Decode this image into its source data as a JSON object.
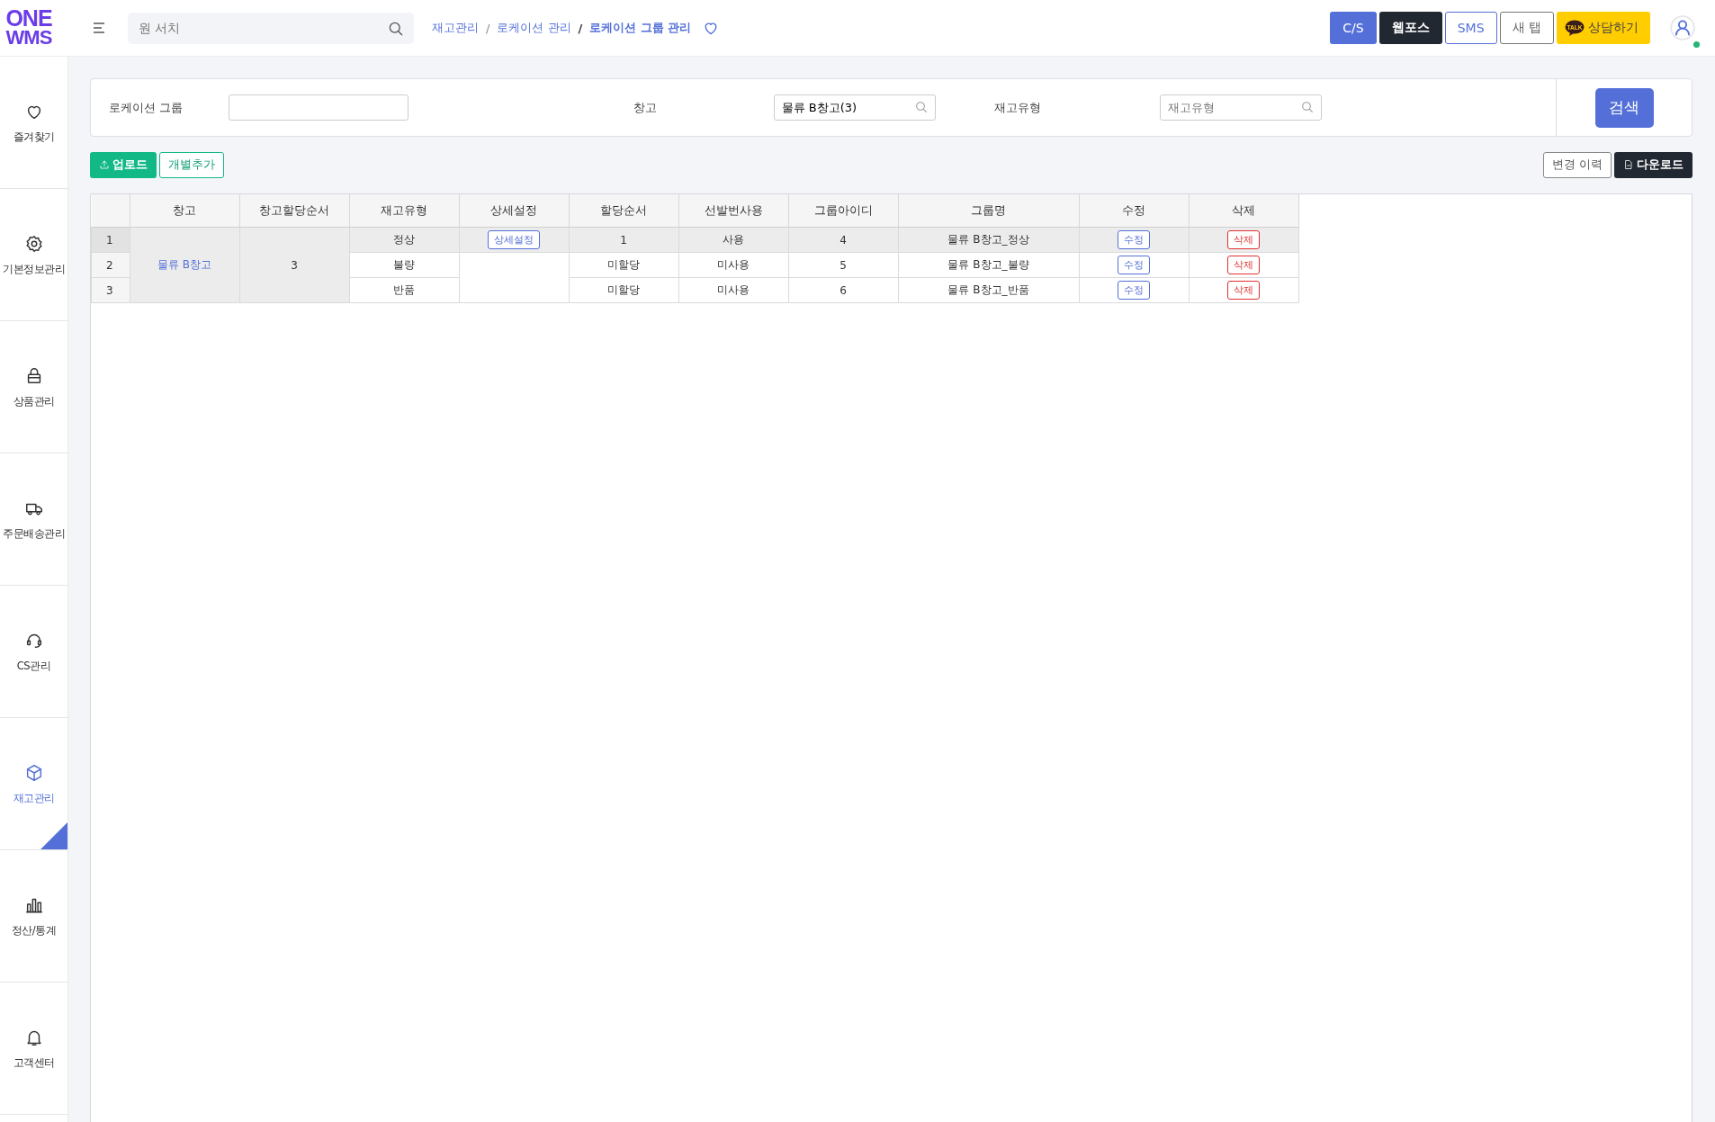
{
  "header": {
    "logo": [
      "ONE",
      "WMS"
    ],
    "search": {
      "placeholder": "원 서치"
    },
    "breadcrumb": [
      {
        "label": "재고관리",
        "current": false
      },
      {
        "separator": "/",
        "label": "로케이션 관리",
        "current": false
      },
      {
        "separator": "/",
        "label": "로케이션 그룹 관리",
        "current": true
      }
    ],
    "favorite": {
      "on": false
    },
    "buttons": [
      {
        "label": "C/S",
        "kind": "primary"
      },
      {
        "label": "웹포스",
        "kind": "dark"
      },
      {
        "label": "SMS",
        "kind": "outline-blue"
      },
      {
        "label": "새 탭",
        "kind": "outline-grey"
      },
      {
        "label": "상담하기",
        "kind": "talk",
        "icon_text": "TALK"
      }
    ],
    "user": {
      "online": true
    }
  },
  "sidebar": {
    "items": [
      {
        "label": "즐겨찾기",
        "selected": false
      },
      {
        "label": "기본정보관리",
        "selected": false
      },
      {
        "label": "상품관리",
        "selected": false
      },
      {
        "label": "주문배송관리",
        "selected": false
      },
      {
        "label": "CS관리",
        "selected": false
      },
      {
        "label": "재고관리",
        "selected": true
      },
      {
        "label": "정산/통계",
        "selected": false
      },
      {
        "label": "고객센터",
        "selected": false
      }
    ]
  },
  "filters": [
    {
      "label": "로케이션 그룹",
      "kind": "text"
    },
    {
      "label": "창고",
      "kind": "select",
      "value": "물류 B창고(3)"
    },
    {
      "label": "재고유형",
      "kind": "select",
      "placeholder": "재고유형"
    }
  ],
  "search_button": "검색",
  "toolbar": {
    "left": [
      {
        "label": "업로드",
        "kind": "upload"
      },
      {
        "label": "개별추가",
        "kind": "outline"
      }
    ],
    "right": [
      {
        "label": "변경 이력",
        "kind": "outline"
      },
      {
        "label": "다운로드",
        "kind": "download"
      }
    ]
  },
  "table": {
    "columns": [
      "창고",
      "창고할당순서",
      "재고유형",
      "상세설정",
      "할당순서",
      "선발번사용",
      "그룹아이디",
      "그룹명",
      "수정",
      "삭제"
    ],
    "warehouse": "물류 B창고",
    "warehouse_order": "3",
    "rows": [
      {
        "number": "1",
        "selected": true,
        "stock_type": "정상",
        "detail_button": "상세설정",
        "alloc_order": "1",
        "first_use": "사용",
        "group_id": "4",
        "group_name": "물류 B창고_정상",
        "edit": "수정",
        "delete": "삭제"
      },
      {
        "number": "2",
        "selected": false,
        "stock_type": "불량",
        "alloc_order": "미할당",
        "first_use": "미사용",
        "group_id": "5",
        "group_name": "물류 B창고_불량",
        "edit": "수정",
        "delete": "삭제"
      },
      {
        "number": "3",
        "selected": false,
        "stock_type": "반품",
        "alloc_order": "미할당",
        "first_use": "미사용",
        "group_id": "6",
        "group_name": "물류 B창고_반품",
        "edit": "수정",
        "delete": "삭제"
      }
    ]
  }
}
